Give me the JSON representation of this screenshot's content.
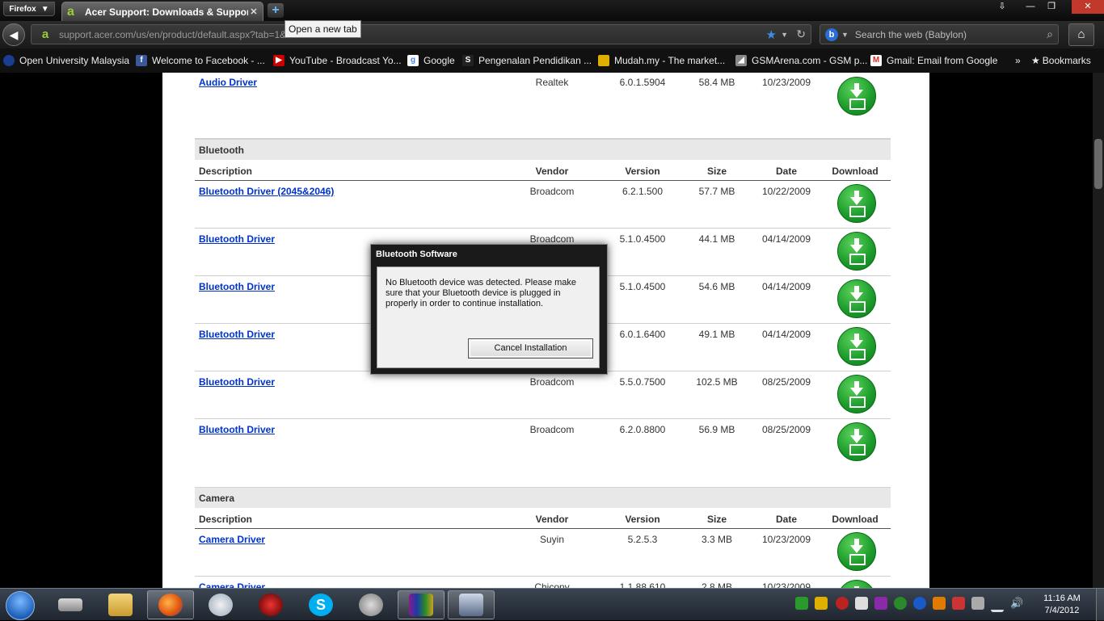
{
  "browser": {
    "menu_label": "Firefox",
    "tab_title": "Acer Support: Downloads & Support D...",
    "tooltip": "Open a new tab",
    "url": "support.acer.com/us/en/product/default.aspx?tab=1&...",
    "search_placeholder": "Search the web (Babylon)",
    "bookmarks": [
      {
        "label": "Open University Malaysia",
        "icon": "oum-icon",
        "color": "#1a3d8f"
      },
      {
        "label": "Welcome to Facebook - ...",
        "icon": "facebook-icon",
        "color": "#3b5998"
      },
      {
        "label": "YouTube - Broadcast Yo...",
        "icon": "youtube-icon",
        "color": "#cc0000"
      },
      {
        "label": "Google",
        "icon": "google-icon",
        "color": "#ffffff"
      },
      {
        "label": "Pengenalan Pendidikan ...",
        "icon": "scribd-icon",
        "color": "#222222"
      },
      {
        "label": "Mudah.my - The market...",
        "icon": "mudah-icon",
        "color": "#e0b000"
      },
      {
        "label": "GSMArena.com - GSM p...",
        "icon": "gsmarena-icon",
        "color": "#888888"
      },
      {
        "label": "Gmail: Email from Google",
        "icon": "gmail-icon",
        "color": "#ffffff"
      }
    ],
    "bookmarks_menu": "Bookmarks"
  },
  "page": {
    "columns": {
      "description": "Description",
      "vendor": "Vendor",
      "version": "Version",
      "size": "Size",
      "date": "Date",
      "download": "Download"
    },
    "audio_row": {
      "description": "Audio Driver",
      "vendor": "Realtek",
      "version": "6.0.1.5904",
      "size": "58.4 MB",
      "date": "10/23/2009"
    },
    "bluetooth": {
      "title": "Bluetooth",
      "rows": [
        {
          "description": "Bluetooth Driver (2045&2046)",
          "vendor": "Broadcom",
          "version": "6.2.1.500",
          "size": "57.7 MB",
          "date": "10/22/2009"
        },
        {
          "description": "Bluetooth Driver",
          "vendor": "Broadcom",
          "version": "5.1.0.4500",
          "size": "44.1 MB",
          "date": "04/14/2009"
        },
        {
          "description": "Bluetooth Driver",
          "vendor": "",
          "version": "5.1.0.4500",
          "size": "54.6 MB",
          "date": "04/14/2009"
        },
        {
          "description": "Bluetooth Driver",
          "vendor": "",
          "version": "6.0.1.6400",
          "size": "49.1 MB",
          "date": "04/14/2009"
        },
        {
          "description": "Bluetooth Driver",
          "vendor": "Broadcom",
          "version": "5.5.0.7500",
          "size": "102.5 MB",
          "date": "08/25/2009"
        },
        {
          "description": "Bluetooth Driver",
          "vendor": "Broadcom",
          "version": "6.2.0.8800",
          "size": "56.9 MB",
          "date": "08/25/2009"
        }
      ]
    },
    "camera": {
      "title": "Camera",
      "rows": [
        {
          "description": "Camera Driver",
          "vendor": "Suyin",
          "version": "5.2.5.3",
          "size": "3.3 MB",
          "date": "10/23/2009"
        },
        {
          "description": "Camera Driver",
          "vendor": "Chicony",
          "version": "1.1.88.610",
          "size": "2.8 MB",
          "date": "10/23/2009"
        }
      ]
    }
  },
  "dialog": {
    "title": "Bluetooth Software",
    "message": "No Bluetooth device was detected. Please make sure that your Bluetooth device is plugged in properly in order to continue installation.",
    "button": "Cancel Installation"
  },
  "taskbar": {
    "apps": [
      "usb-drive-icon",
      "file-explorer-icon",
      "firefox-icon",
      "paint-icon",
      "game-icon",
      "skype-icon",
      "media-icon",
      "winrar-icon",
      "installer-icon"
    ],
    "time": "11:16 AM",
    "date": "7/4/2012"
  },
  "colors": {
    "link": "#0033cc",
    "download_green": "#1a9a2a",
    "accent_blue": "#3b8fe0"
  }
}
